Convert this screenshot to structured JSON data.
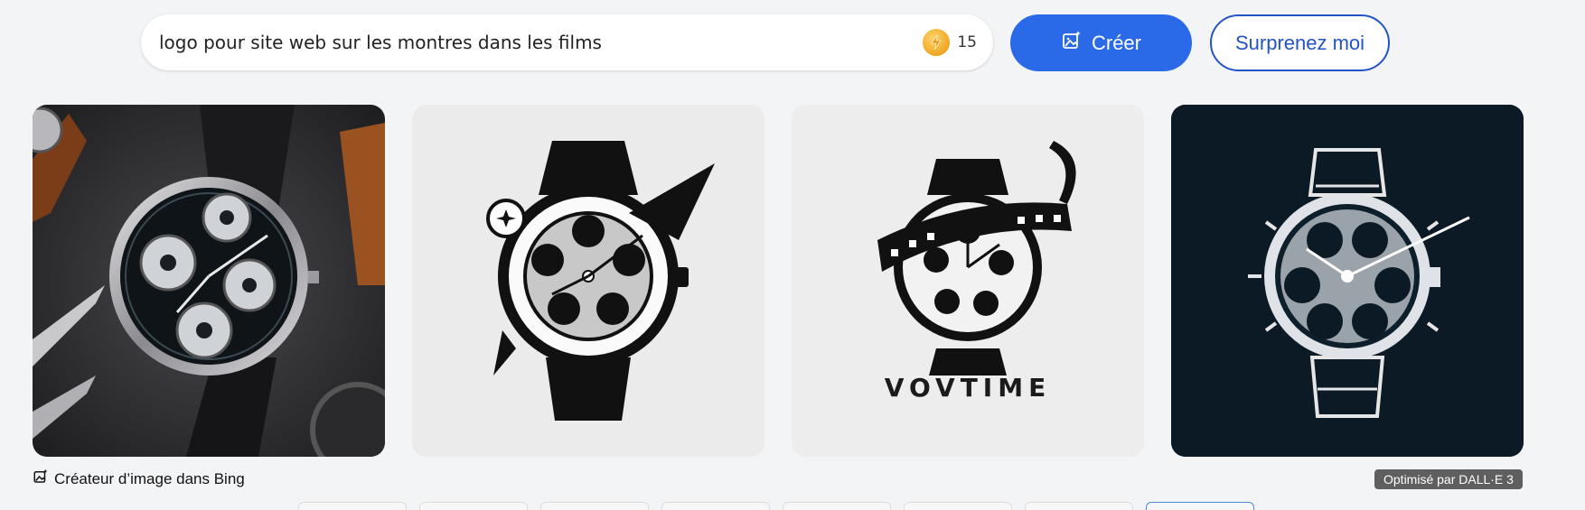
{
  "prompt": {
    "text": "logo pour site web sur les montres dans les films",
    "boost_count": "15"
  },
  "buttons": {
    "create_label": "Créer",
    "surprise_label": "Surprenez moi"
  },
  "images": [
    {
      "label": ""
    },
    {
      "label": ""
    },
    {
      "label": "VOVTIME"
    },
    {
      "label": ""
    }
  ],
  "footer": {
    "creator_label": "Créateur d’image dans Bing",
    "powered_label": "Optimisé par DALL·E 3"
  },
  "colors": {
    "accent": "#2a6ae8",
    "accent_outline": "#2354c6",
    "dark_tile": "#0b1a24"
  }
}
